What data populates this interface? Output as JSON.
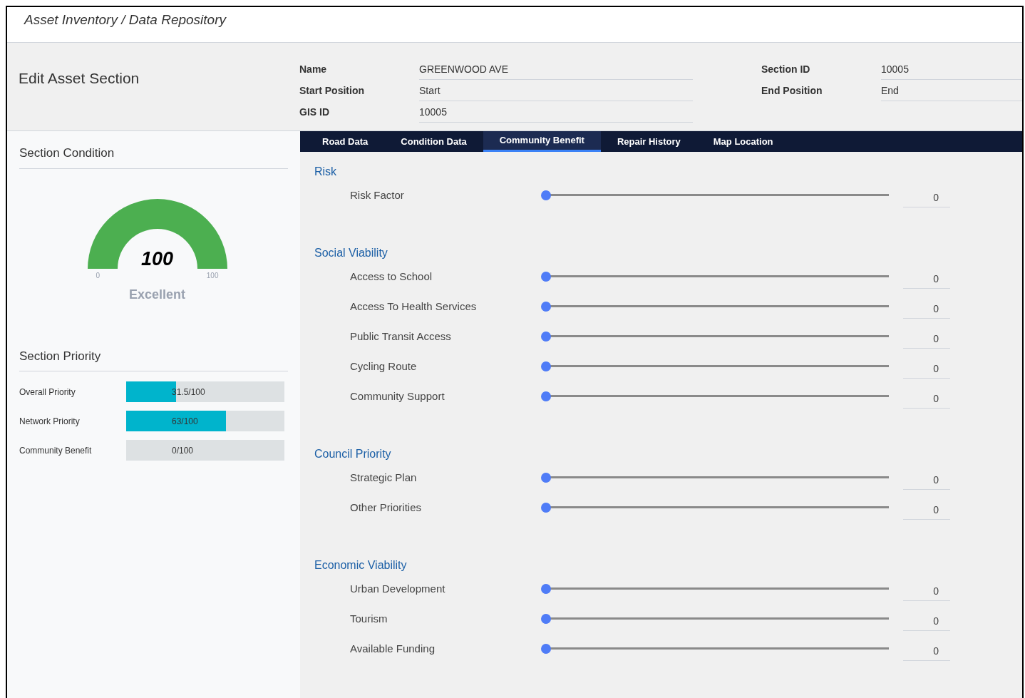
{
  "breadcrumb": "Asset Inventory / Data Repository",
  "page_title": "Edit Asset Section",
  "fields_left": [
    {
      "label": "Name",
      "value": "GREENWOOD AVE"
    },
    {
      "label": "Start Position",
      "value": "Start"
    },
    {
      "label": "GIS ID",
      "value": "10005"
    }
  ],
  "fields_right": [
    {
      "label": "Section ID",
      "value": "10005"
    },
    {
      "label": "End Position",
      "value": "End"
    }
  ],
  "condition": {
    "title": "Section Condition",
    "score": "100",
    "level": 1,
    "min": "0",
    "max": "100",
    "rating": "Excellent"
  },
  "priority": {
    "title": "Section Priority",
    "bars": [
      {
        "label": "Overall Priority",
        "value": "31.5/100",
        "level": 0.315
      },
      {
        "label": "Network Priority",
        "value": "63/100",
        "level": 0.63
      },
      {
        "label": "Community Benefit",
        "value": "0/100"
      }
    ]
  },
  "tabs": [
    {
      "label": "Road Data",
      "selected": false
    },
    {
      "label": "Condition Data",
      "selected": false
    },
    {
      "label": "Community Benefit",
      "selected": true
    },
    {
      "label": "Repair History",
      "selected": false
    },
    {
      "label": "Map Location",
      "selected": false
    }
  ],
  "groups": [
    {
      "title": "Risk",
      "items": [
        {
          "label": "Risk Factor",
          "level": 0,
          "value": "0"
        }
      ]
    },
    {
      "title": "Social Viability",
      "items": [
        {
          "label": "Access to School",
          "level": 0,
          "value": "0"
        },
        {
          "label": "Access To Health Services",
          "level": 0,
          "value": "0"
        },
        {
          "label": "Public Transit Access",
          "level": 0,
          "value": "0"
        },
        {
          "label": "Cycling Route",
          "level": 0,
          "value": "0"
        },
        {
          "label": "Community Support",
          "level": 0,
          "value": "0"
        }
      ]
    },
    {
      "title": "Council Priority",
      "items": [
        {
          "label": "Strategic Plan",
          "level": 0,
          "value": "0"
        },
        {
          "label": "Other Priorities",
          "level": 0,
          "value": "0"
        }
      ]
    },
    {
      "title": "Economic Viability",
      "items": [
        {
          "label": "Urban Development",
          "level": 0,
          "value": "0"
        },
        {
          "label": "Tourism",
          "level": 0,
          "value": "0"
        },
        {
          "label": "Available Funding",
          "level": 0,
          "value": "0"
        }
      ]
    }
  ]
}
